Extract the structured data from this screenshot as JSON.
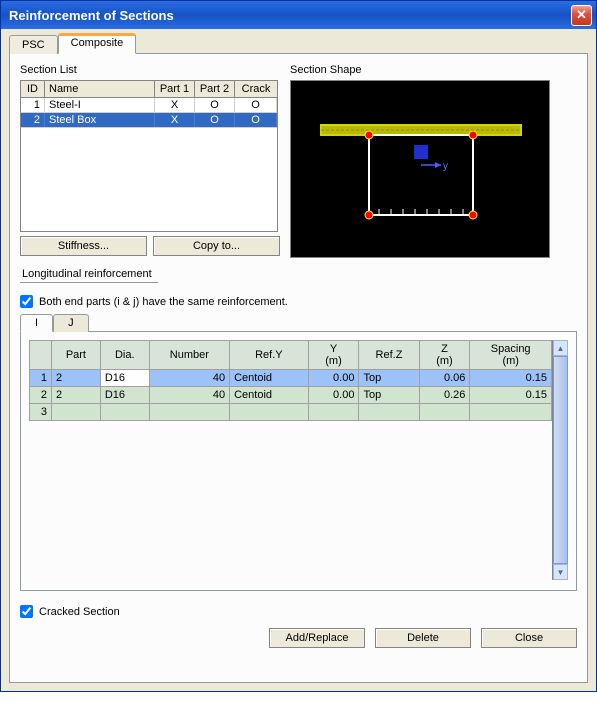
{
  "window": {
    "title": "Reinforcement of Sections"
  },
  "tabs": {
    "psc": "PSC",
    "composite": "Composite"
  },
  "section_list": {
    "label": "Section List",
    "headers": {
      "id": "ID",
      "name": "Name",
      "p1": "Part 1",
      "p2": "Part 2",
      "crack": "Crack"
    },
    "rows": [
      {
        "id": "1",
        "name": "Steel-I",
        "p1": "X",
        "p2": "O",
        "crack": "O",
        "selected": false
      },
      {
        "id": "2",
        "name": "Steel Box",
        "p1": "X",
        "p2": "O",
        "crack": "O",
        "selected": true
      }
    ],
    "buttons": {
      "stiffness": "Stiffness...",
      "copy": "Copy to..."
    }
  },
  "section_shape": {
    "label": "Section Shape",
    "axis_y": "y"
  },
  "long_reinf": {
    "label": "Longitudinal reinforcement",
    "same_ends_label": "Both end parts (i & j) have the same reinforcement.",
    "same_ends_checked": true,
    "subtabs": {
      "i": "I",
      "j": "J"
    },
    "headers": {
      "part": "Part",
      "dia": "Dia.",
      "num": "Number",
      "refy": "Ref.Y",
      "y": "Y\n(m)",
      "refz": "Ref.Z",
      "z": "Z\n(m)",
      "spacing": "Spacing\n(m)"
    },
    "rows": [
      {
        "idx": "1",
        "part": "2",
        "dia": "D16",
        "num": "40",
        "refy": "Centoid",
        "y": "0.00",
        "refz": "Top",
        "z": "0.06",
        "spacing": "0.15"
      },
      {
        "idx": "2",
        "part": "2",
        "dia": "D16",
        "num": "40",
        "refy": "Centoid",
        "y": "0.00",
        "refz": "Top",
        "z": "0.26",
        "spacing": "0.15"
      },
      {
        "idx": "3",
        "part": "",
        "dia": "",
        "num": "",
        "refy": "",
        "y": "",
        "refz": "",
        "z": "",
        "spacing": ""
      }
    ]
  },
  "cracked": {
    "label": "Cracked Section",
    "checked": true
  },
  "bottom": {
    "add": "Add/Replace",
    "delete": "Delete",
    "close": "Close"
  }
}
